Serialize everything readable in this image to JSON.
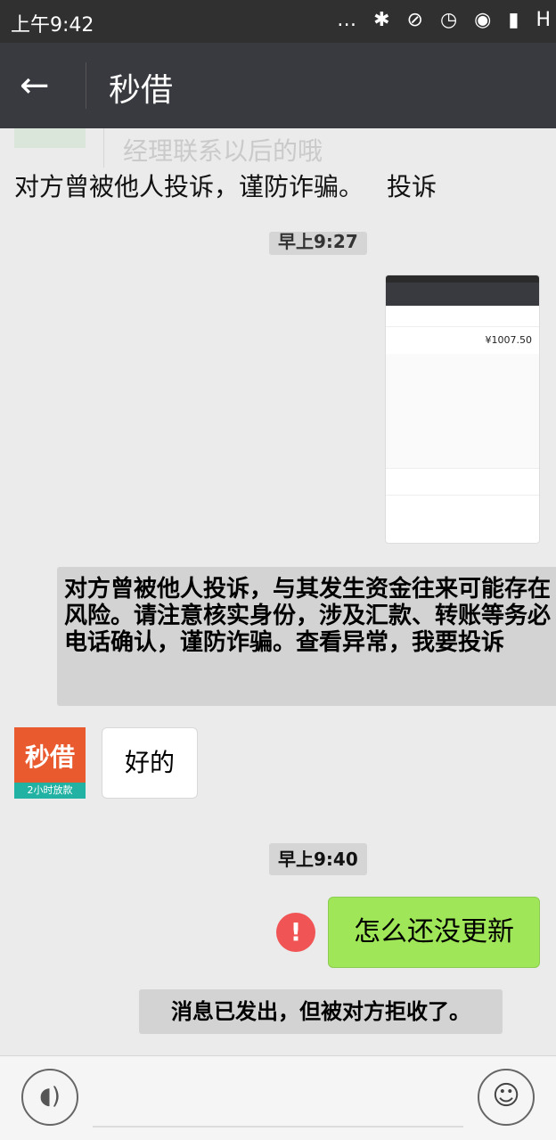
{
  "status_bar": {
    "time": "上午9:42",
    "icons_text": "… ✱ ⊘ ◷ ◉ ▮ H"
  },
  "header": {
    "back_icon": "back-arrow-icon",
    "back_glyph": "←",
    "title": "秒借"
  },
  "chat": {
    "ghost_text": "经理联系以后的哦",
    "complaint_notice": "对方曾被他人投诉，谨防诈骗。",
    "complaint_link": "投诉",
    "time_1": "早上9:27",
    "image_message": {
      "amount": "¥1007.50"
    },
    "risk_notice": "对方曾被他人投诉，与其发生资金往来可能存在风险。请注意核实身份，涉及汇款、转账等务必电话确认，谨防诈骗。查看异常，我要投诉",
    "avatar_brand": "秒借",
    "avatar_slogan": "2小时放款",
    "received_message": "好的",
    "time_2": "早上9:40",
    "error_glyph": "!",
    "sent_message": "怎么还没更新",
    "reject_notice": "消息已发出，但被对方拒收了。"
  },
  "input_bar": {
    "voice_glyph": "◖)",
    "emoji_glyph": "☺"
  },
  "colors": {
    "header_bg": "#393a3f",
    "sent_bubble": "#9fe658",
    "error_red": "#f05454",
    "brand_orange": "#e95a2f",
    "brand_teal": "#21b2a3"
  }
}
